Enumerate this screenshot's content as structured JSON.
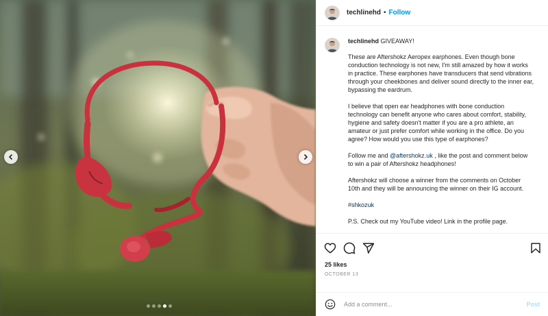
{
  "post": {
    "username": "techlinehd",
    "follow_label": "Follow",
    "header_separator": "•",
    "caption": {
      "intro": "GIVEAWAY!",
      "paragraphs": [
        "These are Aftershokz Aeropex earphones. Even though bone conduction technology is not new, I'm still amazed by how it works in practice. These earphones have transducers that send vibrations through your cheekbones and deliver sound directly to the inner ear, bypassing the eardrum.",
        "I believe that open ear headphones with bone conduction technology can benefit anyone who cares about comfort, stability, hygiene and safety doesn't matter if you are a pro athlete, an amateur or just prefer comfort while working in the office. Do you agree? How would you use this type of earphones?"
      ],
      "follow_para": {
        "before": "Follow me and ",
        "mention": "@aftershokz.uk",
        "after": " , like the post and comment below to win a pair of Aftershokz headphones!"
      },
      "winner_para": "Aftershokz will choose a winner from the comments on October 10th and they will be announcing the winner on their IG account.",
      "hashtag": "#shkozuk",
      "ps": "P.S. Check out my YouTube video! Link in the profile page."
    },
    "likes_text": "25 likes",
    "date_text": "OCTOBER 13",
    "comment": {
      "placeholder": "Add a comment...",
      "post_label": "Post"
    },
    "carousel": {
      "slide_count": 5,
      "active_index": 3
    },
    "icons": {
      "like": "heart-icon",
      "comment": "comment-icon",
      "share": "share-icon",
      "save": "bookmark-icon",
      "emoji": "emoji-icon",
      "prev": "chevron-left-icon",
      "next": "chevron-right-icon"
    },
    "colors": {
      "link": "#0095f6",
      "mention": "#00376b",
      "post_disabled": "#b2dffc",
      "muted": "#8e8e8e"
    }
  }
}
